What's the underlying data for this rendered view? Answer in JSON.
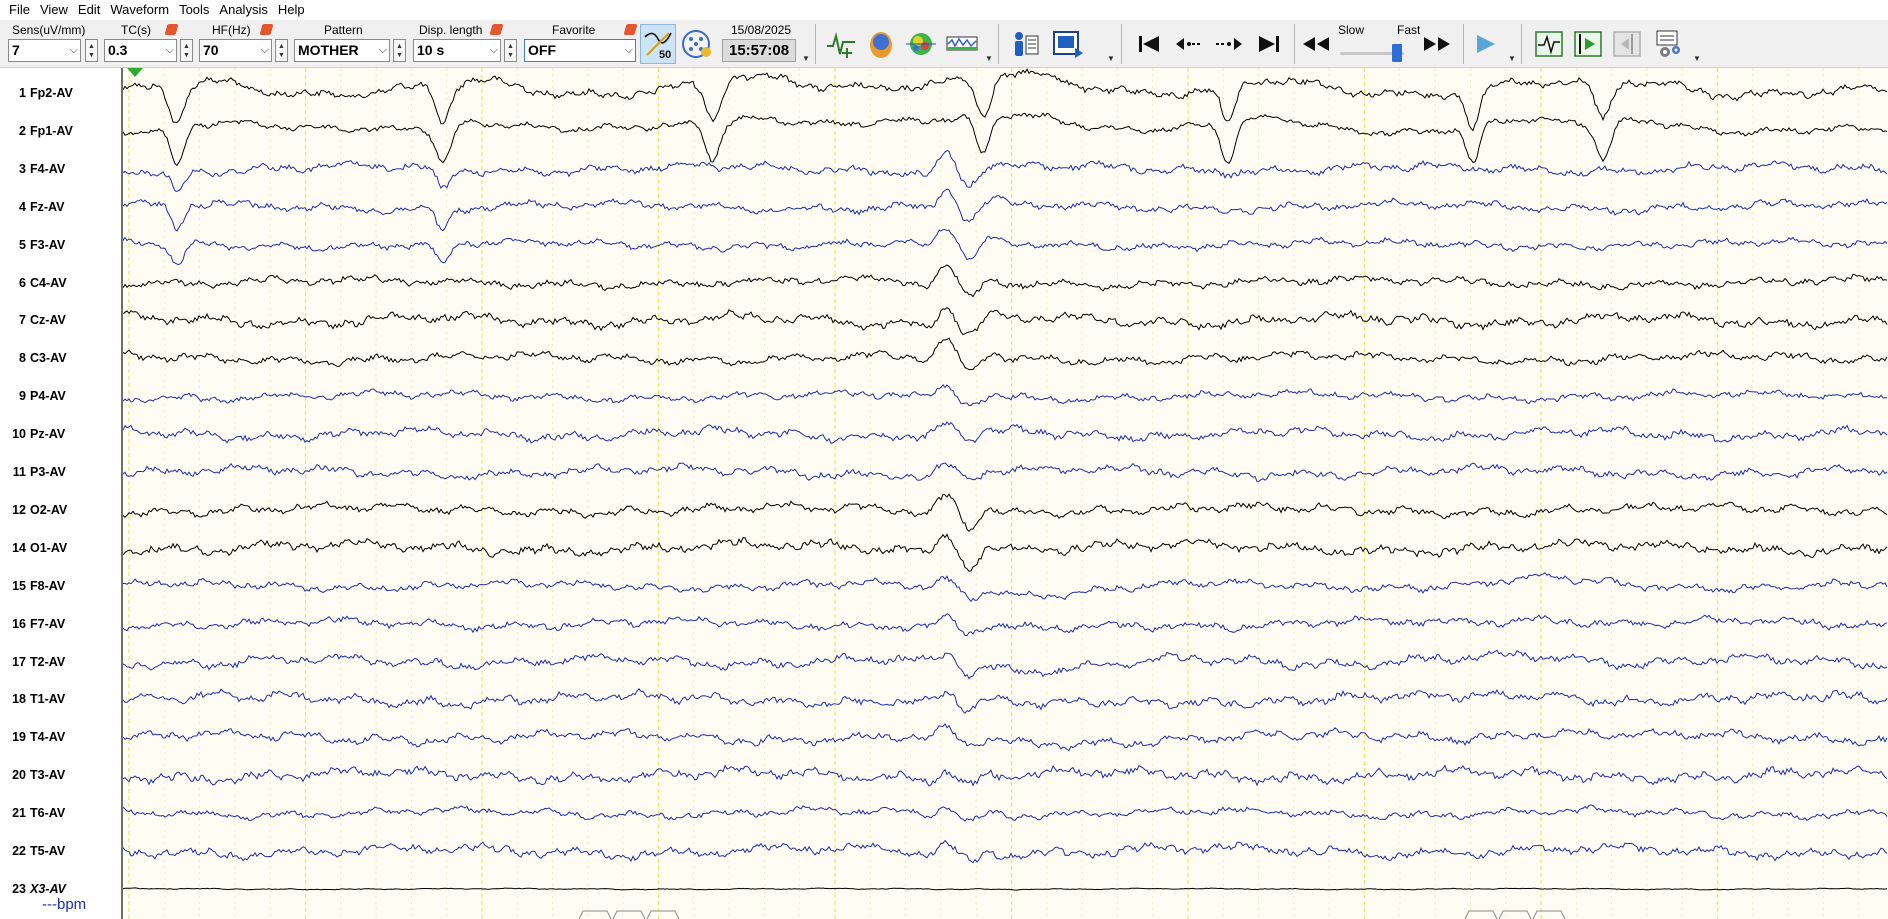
{
  "menu": [
    "File",
    "View",
    "Edit",
    "Waveform",
    "Tools",
    "Analysis",
    "Help"
  ],
  "toolbar": {
    "sens": {
      "label": "Sens(uV/mm)",
      "value": "7"
    },
    "tc": {
      "label": "TC(s)",
      "value": "0.3"
    },
    "hf": {
      "label": "HF(Hz)",
      "value": "70"
    },
    "pattern": {
      "label": "Pattern",
      "value": "MOTHER"
    },
    "disp_length": {
      "label": "Disp. length",
      "value": "10 s"
    },
    "favorite": {
      "label": "Favorite",
      "value": "OFF"
    },
    "filter_badge": "50",
    "date": "15/08/2025",
    "time": "15:57:08",
    "speed_slow": "Slow",
    "speed_fast": "Fast"
  },
  "channels": [
    {
      "num": "1",
      "name": "Fp2-AV",
      "color": "#000000"
    },
    {
      "num": "2",
      "name": "Fp1-AV",
      "color": "#000000"
    },
    {
      "num": "3",
      "name": "F4-AV",
      "color": "#1a2fb0"
    },
    {
      "num": "4",
      "name": "Fz-AV",
      "color": "#1a2fb0"
    },
    {
      "num": "5",
      "name": "F3-AV",
      "color": "#1a2fb0"
    },
    {
      "num": "6",
      "name": "C4-AV",
      "color": "#000000"
    },
    {
      "num": "7",
      "name": "Cz-AV",
      "color": "#000000"
    },
    {
      "num": "8",
      "name": "C3-AV",
      "color": "#000000"
    },
    {
      "num": "9",
      "name": "P4-AV",
      "color": "#1a2fb0"
    },
    {
      "num": "10",
      "name": "Pz-AV",
      "color": "#1a2fb0"
    },
    {
      "num": "11",
      "name": "P3-AV",
      "color": "#1a2fb0"
    },
    {
      "num": "12",
      "name": "O2-AV",
      "color": "#000000"
    },
    {
      "num": "14",
      "name": "O1-AV",
      "color": "#000000"
    },
    {
      "num": "15",
      "name": "F8-AV",
      "color": "#1a2fb0"
    },
    {
      "num": "16",
      "name": "F7-AV",
      "color": "#1a2fb0"
    },
    {
      "num": "17",
      "name": "T2-AV",
      "color": "#1a2fb0"
    },
    {
      "num": "18",
      "name": "T1-AV",
      "color": "#1a2fb0"
    },
    {
      "num": "19",
      "name": "T4-AV",
      "color": "#1a2fb0"
    },
    {
      "num": "20",
      "name": "T3-AV",
      "color": "#1a2fb0"
    },
    {
      "num": "21",
      "name": "T6-AV",
      "color": "#1a2fb0"
    },
    {
      "num": "22",
      "name": "T5-AV",
      "color": "#1a2fb0"
    },
    {
      "num": "23",
      "name": "X3-AV",
      "color": "#000000",
      "italic": true
    }
  ],
  "heart_rate": "---bpm",
  "colors": {
    "trace_black": "#000000",
    "trace_blue": "#1a2fb0",
    "grid_yellow": "#f2e46a",
    "marker_green": "#2fa82f",
    "background": "#fffdf3"
  }
}
